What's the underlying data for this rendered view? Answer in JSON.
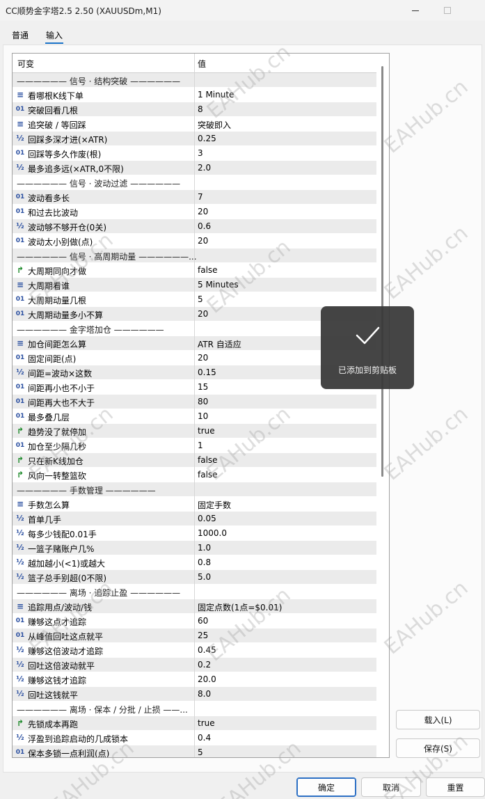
{
  "window": {
    "title": "CC顺势金字塔2.5 2.50 (XAUUSDm,M1)"
  },
  "tabs": [
    {
      "label": "普通"
    },
    {
      "label": "输入"
    }
  ],
  "grid": {
    "col_name": "可变",
    "col_value": "值",
    "rows": [
      {
        "type": "section",
        "name": "—————— 信号 · 结构突破 ——————",
        "value": ""
      },
      {
        "type": "enum",
        "name": "看哪根K线下单",
        "value": "1 Minute"
      },
      {
        "type": "int",
        "name": "突破回看几根",
        "value": "8"
      },
      {
        "type": "enum",
        "name": "追突破 / 等回踩",
        "value": "突破即入"
      },
      {
        "type": "double",
        "name": "回踩多深才进(×ATR)",
        "value": "0.25"
      },
      {
        "type": "int",
        "name": "回踩等多久作废(根)",
        "value": "3"
      },
      {
        "type": "double",
        "name": "最多追多远(×ATR,0不限)",
        "value": "2.0"
      },
      {
        "type": "section",
        "name": "—————— 信号 · 波动过滤 ——————",
        "value": ""
      },
      {
        "type": "int",
        "name": "波动看多长",
        "value": "7"
      },
      {
        "type": "int",
        "name": "和过去比波动",
        "value": "20"
      },
      {
        "type": "double",
        "name": "波动够不够开仓(0关)",
        "value": "0.6"
      },
      {
        "type": "int",
        "name": "波动太小别做(点)",
        "value": "20"
      },
      {
        "type": "section",
        "name": "—————— 信号 · 高周期动量 ——————...",
        "value": ""
      },
      {
        "type": "bool",
        "name": "大周期同向才做",
        "value": "false"
      },
      {
        "type": "enum",
        "name": "大周期看谁",
        "value": "5 Minutes"
      },
      {
        "type": "int",
        "name": "大周期动量几根",
        "value": "5"
      },
      {
        "type": "int",
        "name": "大周期动量多小不算",
        "value": "20"
      },
      {
        "type": "section",
        "name": "—————— 金字塔加仓 ——————",
        "value": ""
      },
      {
        "type": "enum",
        "name": "加仓间距怎么算",
        "value": "ATR 自适应"
      },
      {
        "type": "int",
        "name": "固定间距(点)",
        "value": "20"
      },
      {
        "type": "double",
        "name": "间距=波动×这数",
        "value": "0.15"
      },
      {
        "type": "int",
        "name": "间距再小也不小于",
        "value": "15"
      },
      {
        "type": "int",
        "name": "间距再大也不大于",
        "value": "80"
      },
      {
        "type": "int",
        "name": "最多叠几层",
        "value": "10"
      },
      {
        "type": "bool",
        "name": "趋势没了就停加",
        "value": "true"
      },
      {
        "type": "int",
        "name": "加仓至少隔几秒",
        "value": "1"
      },
      {
        "type": "bool",
        "name": "只在新K线加仓",
        "value": "false"
      },
      {
        "type": "bool",
        "name": "风向一转整篮砍",
        "value": "false"
      },
      {
        "type": "section",
        "name": "—————— 手数管理 ——————",
        "value": ""
      },
      {
        "type": "enum",
        "name": "手数怎么算",
        "value": "固定手数"
      },
      {
        "type": "double",
        "name": "首单几手",
        "value": "0.05"
      },
      {
        "type": "double",
        "name": "每多少钱配0.01手",
        "value": "1000.0"
      },
      {
        "type": "double",
        "name": "一篮子赌账户几%",
        "value": "1.0"
      },
      {
        "type": "double",
        "name": "越加越小(<1)或越大",
        "value": "0.8"
      },
      {
        "type": "double",
        "name": "篮子总手别超(0不限)",
        "value": "5.0"
      },
      {
        "type": "section",
        "name": "—————— 离场 · 追踪止盈 ——————",
        "value": ""
      },
      {
        "type": "enum",
        "name": "追踪用点/波动/钱",
        "value": "固定点数(1点=$0.01)"
      },
      {
        "type": "int",
        "name": "赚够这点才追踪",
        "value": "60"
      },
      {
        "type": "int",
        "name": "从峰值回吐这点就平",
        "value": "25"
      },
      {
        "type": "double",
        "name": "赚够这倍波动才追踪",
        "value": "0.45"
      },
      {
        "type": "double",
        "name": "回吐这倍波动就平",
        "value": "0.2"
      },
      {
        "type": "double",
        "name": "赚够这钱才追踪",
        "value": "20.0"
      },
      {
        "type": "double",
        "name": "回吐这钱就平",
        "value": "8.0"
      },
      {
        "type": "section",
        "name": "—————— 离场 · 保本 / 分批 / 止损 ——...",
        "value": ""
      },
      {
        "type": "bool",
        "name": "先锁成本再跑",
        "value": "true"
      },
      {
        "type": "double",
        "name": "浮盈到追踪启动的几成锁本",
        "value": "0.4"
      },
      {
        "type": "int",
        "name": "保本多锁一点利润(点)",
        "value": "5"
      }
    ]
  },
  "buttons": {
    "load": "载入(L)",
    "save": "保存(S)",
    "ok": "确定",
    "cancel": "取消",
    "reset": "重置"
  },
  "toast": {
    "message": "已添加到剪贴板"
  },
  "watermark": "EAHub.cn",
  "icons": {
    "int": "01",
    "double": "½",
    "bool": "↱",
    "enum": "≡"
  },
  "colors": {
    "accent": "#1a73c8",
    "row_alt": "#ebebeb",
    "toast_bg": "#373737"
  }
}
